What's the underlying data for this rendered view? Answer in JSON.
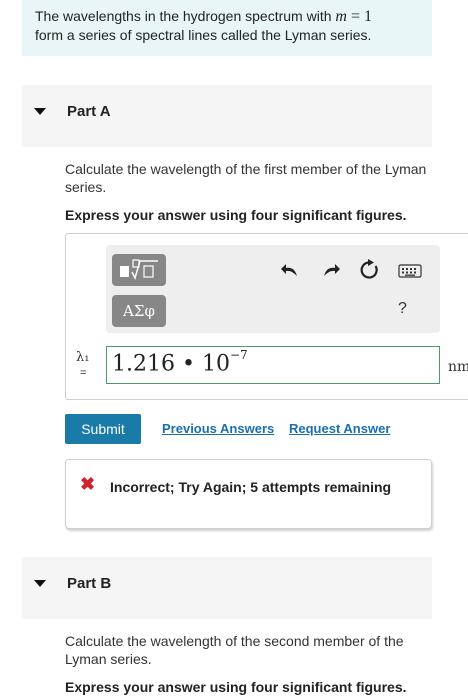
{
  "intro": {
    "text_before": "The wavelengths in the hydrogen spectrum with ",
    "math_var": "m",
    "math_rest": " = 1",
    "text_after": "form a series of spectral lines called the Lyman series."
  },
  "part_a": {
    "title": "Part A",
    "question": "Calculate the wavelength of the first member of the Lyman series.",
    "instruction": "Express your answer using four significant figures.",
    "toolbar": {
      "templates_icon": "template-radical-icon",
      "greek_label": "ΑΣφ",
      "help_label": "?"
    },
    "variable_label": "λ₁",
    "variable_eq": "=",
    "answer": {
      "mantissa": "1.216 • 10",
      "exponent": "−7"
    },
    "unit": "nm",
    "submit_label": "Submit",
    "previous_answers_label": "Previous Answers",
    "request_answer_label": "Request Answer",
    "feedback": {
      "text": "Incorrect; Try Again; 5 attempts remaining",
      "color": "#d0212f"
    }
  },
  "part_b": {
    "title": "Part B",
    "question": "Calculate the wavelength of the second member of the Lyman series.",
    "instruction": "Express your answer using four significant figures."
  },
  "colors": {
    "intro_bg": "#e9f6f8",
    "submit_bg": "#1a7aa8",
    "link": "#1a6fb0",
    "input_border": "#4a9d6a"
  }
}
